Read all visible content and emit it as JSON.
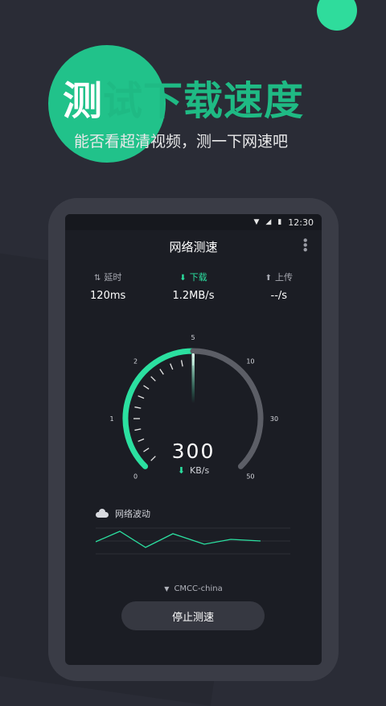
{
  "promo": {
    "title_first": "测",
    "title_rest": "试下载速度",
    "subtitle": "能否看超清视频，测一下网速吧"
  },
  "statusbar": {
    "time": "12:30",
    "wifi_icon": "wifi-icon",
    "signal_icon": "signal-icon",
    "battery_icon": "battery-icon"
  },
  "app": {
    "title": "网络测速",
    "more_icon": "more-vertical-icon"
  },
  "stats": [
    {
      "label": "延时",
      "value": "120ms",
      "icon": "updown-arrows-icon",
      "active": false
    },
    {
      "label": "下载",
      "value": "1.2MB/s",
      "icon": "download-icon",
      "active": true
    },
    {
      "label": "上传",
      "value": "--/s",
      "icon": "upload-icon",
      "active": false
    }
  ],
  "gauge": {
    "scale_labels": [
      "0",
      "1",
      "2",
      "5",
      "10",
      "30",
      "50"
    ],
    "value": "300",
    "unit": "KB/s",
    "unit_icon": "download-icon",
    "filled_ticks_fraction": 0.5
  },
  "wave": {
    "label": "网络波动",
    "icon": "cloud-icon"
  },
  "network": {
    "name": "CMCC-china",
    "icon": "dropdown-triangle-icon"
  },
  "action": {
    "stop_label": "停止测速"
  },
  "colors": {
    "accent": "#2be0a0",
    "background": "#2a2c36",
    "screen": "#1b1d24"
  }
}
